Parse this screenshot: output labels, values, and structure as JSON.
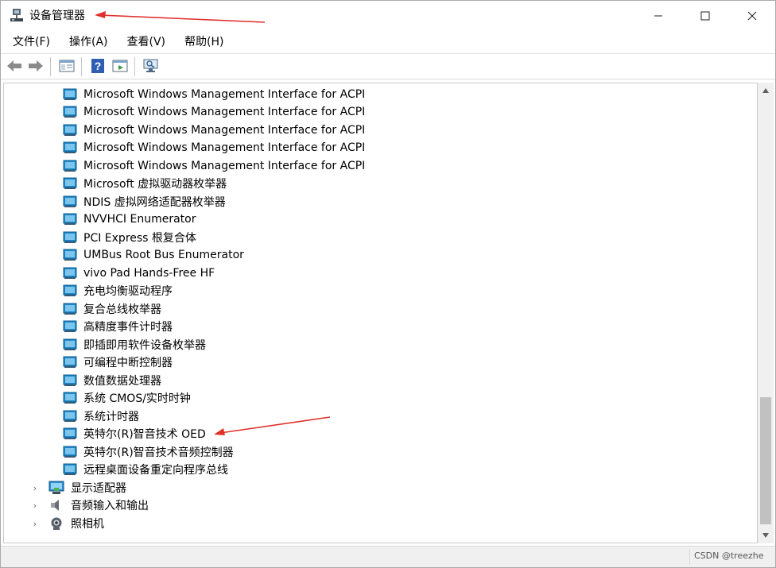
{
  "window": {
    "title": "设备管理器"
  },
  "menu": {
    "items": [
      "文件(F)",
      "操作(A)",
      "查看(V)",
      "帮助(H)"
    ]
  },
  "toolbar": {
    "buttons": [
      "back-icon",
      "forward-icon",
      "properties-panel-icon",
      "help-icon",
      "action-panel-icon",
      "scan-hardware-icon"
    ]
  },
  "tree": {
    "devices": [
      "Microsoft Windows Management Interface for ACPI",
      "Microsoft Windows Management Interface for ACPI",
      "Microsoft Windows Management Interface for ACPI",
      "Microsoft Windows Management Interface for ACPI",
      "Microsoft Windows Management Interface for ACPI",
      "Microsoft 虚拟驱动器枚举器",
      "NDIS 虚拟网络适配器枚举器",
      "NVVHCI Enumerator",
      "PCI Express 根复合体",
      "UMBus Root Bus Enumerator",
      "vivo Pad Hands-Free HF",
      "充电均衡驱动程序",
      "复合总线枚举器",
      "高精度事件计时器",
      "即插即用软件设备枚举器",
      "可编程中断控制器",
      "数值数据处理器",
      "系统 CMOS/实时时钟",
      "系统计时器",
      "英特尔(R)智音技术 OED",
      "英特尔(R)智音技术音频控制器",
      "远程桌面设备重定向程序总线"
    ],
    "categories": [
      {
        "label": "显示适配器",
        "icon": "display-adapter-icon"
      },
      {
        "label": "音频输入和输出",
        "icon": "speaker-icon"
      },
      {
        "label": "照相机",
        "icon": "camera-icon"
      }
    ]
  },
  "status": {
    "watermark": "CSDN @treezhe"
  },
  "colors": {
    "annotation_arrow": "#e0302a",
    "device_icon": "#1e88c8"
  }
}
